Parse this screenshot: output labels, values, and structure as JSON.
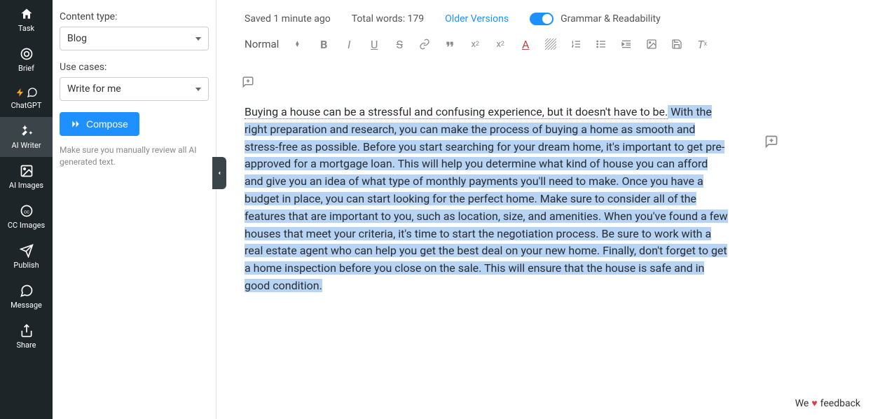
{
  "sidebar": {
    "items": [
      {
        "label": "Task"
      },
      {
        "label": "Brief"
      },
      {
        "label": "ChatGPT"
      },
      {
        "label": "AI Writer"
      },
      {
        "label": "AI Images"
      },
      {
        "label": "CC Images"
      },
      {
        "label": "Publish"
      },
      {
        "label": "Message"
      },
      {
        "label": "Share"
      }
    ]
  },
  "settings": {
    "content_type_label": "Content type:",
    "content_type_value": "Blog",
    "use_cases_label": "Use cases:",
    "use_cases_value": "Write for me",
    "compose_label": "Compose",
    "review_note": "Make sure you manually review all AI generated text."
  },
  "topbar": {
    "saved": "Saved 1 minute ago",
    "total_words": "Total words: 179",
    "older_versions": "Older Versions",
    "grammar_label": "Grammar & Readability"
  },
  "toolbar": {
    "format_label": "Normal"
  },
  "editor": {
    "text_plain": "Buying a house can be a stressful and confusing experience, but it doesn't have to be.",
    "text_highlighted": " With the right preparation and research, you can make the process of buying a home as smooth and stress-free as possible. Before you start searching for your dream home, it's important to get pre-approved for a mortgage loan. This will help you determine what kind of house you can afford and give you an idea of what type of monthly payments you'll need to make. Once you have a budget in place, you can start looking for the perfect home. Make sure to consider all of the features that are important to you, such as location, size, and amenities. When you've found a few houses that meet your criteria, it's time to start the negotiation process. Be sure to work with a real estate agent who can help you get the best deal on your new home. Finally, don't forget to get a home inspection before you close on the sale. This will ensure that the house is safe and in good condition."
  },
  "feedback": {
    "prefix": "We",
    "suffix": "feedback"
  }
}
